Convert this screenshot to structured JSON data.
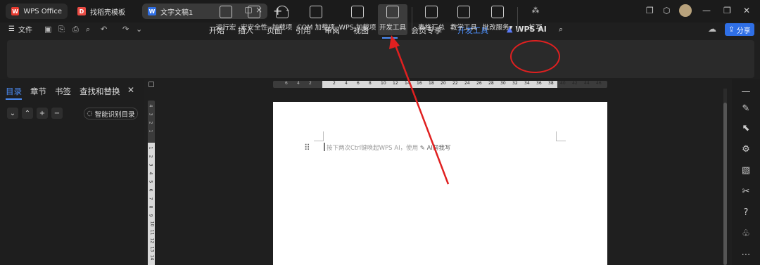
{
  "titlebar": {
    "tabs": [
      {
        "label": "WPS Office",
        "icon": "wps-logo-icon",
        "color": "#e83b30"
      },
      {
        "label": "找稻壳模板",
        "icon": "docer-icon",
        "color": "#e94b43"
      },
      {
        "label": "文字文稿1",
        "icon": "word-doc-icon",
        "color": "#2f6fe6"
      }
    ]
  },
  "menubar": {
    "file_label": "文件",
    "tabs": [
      "开始",
      "插入",
      "页面",
      "引用",
      "审阅",
      "视图",
      "工具",
      "会员专享",
      "开发工具",
      "WPS AI"
    ],
    "active_tab": "工具",
    "share_label": "分享"
  },
  "ribbon": {
    "tools": [
      "运行宏",
      "宏安全性",
      "加载项",
      "COM 加载项",
      "WPS 加载项",
      "开发工具",
      "表格汇总",
      "教学工具",
      "批改服务",
      "扩写"
    ],
    "dropdown_suffix": "▾"
  },
  "left_panel": {
    "tabs": [
      "目录",
      "章节",
      "书签",
      "查找和替换"
    ],
    "smart_toc_label": "智能识别目录"
  },
  "ruler": {
    "h_ticks": [
      "6",
      "4",
      "2",
      "",
      "2",
      "4",
      "6",
      "8",
      "10",
      "12",
      "14",
      "16",
      "18",
      "20",
      "22",
      "24",
      "26",
      "28",
      "30",
      "32",
      "34",
      "36",
      "38",
      "40",
      "42",
      "44",
      "46"
    ],
    "v_ticks": [
      "4",
      "3",
      "2",
      "1",
      "",
      "1",
      "2",
      "3",
      "4",
      "5",
      "6",
      "7",
      "8",
      "9",
      "10",
      "11",
      "12",
      "13",
      "14"
    ]
  },
  "document": {
    "hint_text": "按下两次Ctrl键唤起WPS AI，使用",
    "ai_write_label": "AI帮我写"
  },
  "colors": {
    "accent": "#4c8cf5",
    "annotation": "#e02020",
    "share": "#2f6fe6"
  }
}
